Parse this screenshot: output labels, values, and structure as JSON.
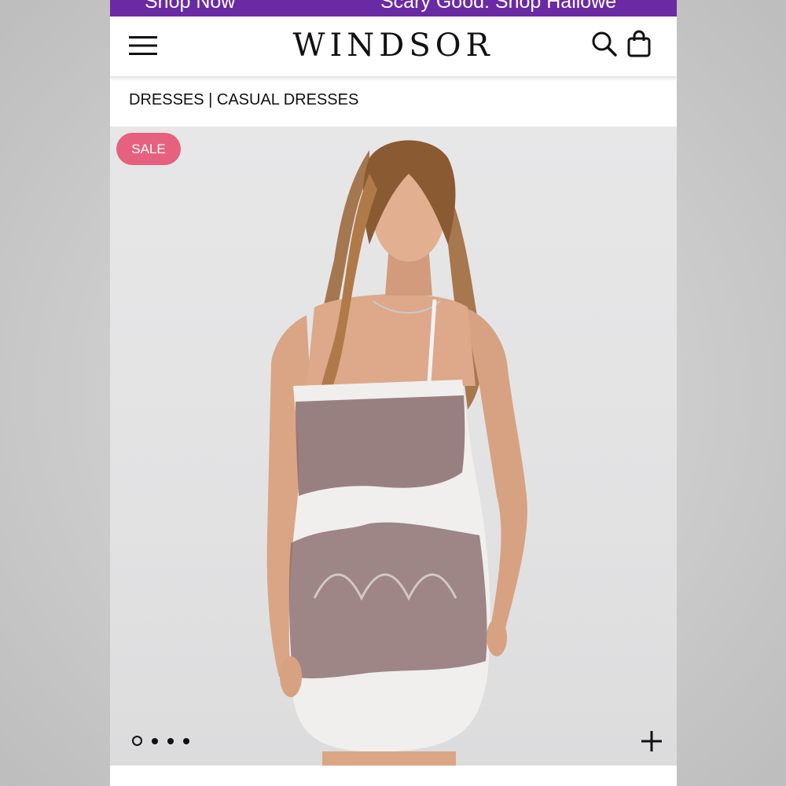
{
  "promo": {
    "left_text": "Shop Now",
    "right_text": "Scary Good: Shop Hallowe"
  },
  "header": {
    "logo": "WINDSOR",
    "menu_icon": "hamburger-menu-icon",
    "search_icon": "search-icon",
    "bag_icon": "shopping-bag-icon"
  },
  "breadcrumb": "DRESSES | CASUAL DRESSES",
  "product": {
    "sale_badge": "SALE",
    "image_alt": "Model wearing a white and mauve tie-dye sleeveless mini dress",
    "carousel_total": 4,
    "carousel_active": 1,
    "expand_icon": "plus-icon"
  },
  "colors": {
    "promo_bg": "#6a2aa3",
    "sale_badge": "#e6617e",
    "text": "#111111"
  }
}
